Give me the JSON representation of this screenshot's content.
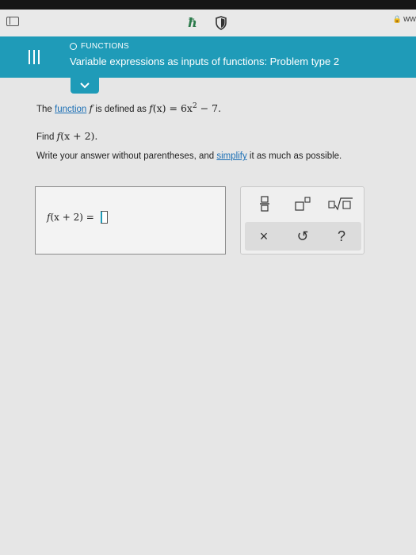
{
  "browser": {
    "url_text": "ww"
  },
  "header": {
    "section": "FUNCTIONS",
    "title": "Variable expressions as inputs of functions: Problem type 2"
  },
  "problem": {
    "line1": {
      "prefix": "The ",
      "link": "function",
      "fvar": "f",
      "mid": " is defined as ",
      "expr_lhs": "f",
      "expr_arg": "(x)",
      "expr_rhs_a": " = 6x",
      "expr_exp": "2",
      "expr_rhs_b": " − 7."
    },
    "line2": {
      "prefix": "Find ",
      "f": "f",
      "arg": "(x + 2)."
    },
    "line3": {
      "prefix": "Write your answer without parentheses, and ",
      "link": "simplify",
      "suffix": " it as much as possible."
    }
  },
  "answer": {
    "f": "f",
    "label": "(x + 2) ="
  },
  "palette": {
    "row1": [
      "fraction-icon",
      "superscript-icon",
      "nth-root-icon"
    ],
    "clear_symbol": "×",
    "undo_symbol": "↺",
    "help_symbol": "?"
  },
  "colors": {
    "header": "#1f9bb8",
    "link": "#1b6fb5"
  }
}
